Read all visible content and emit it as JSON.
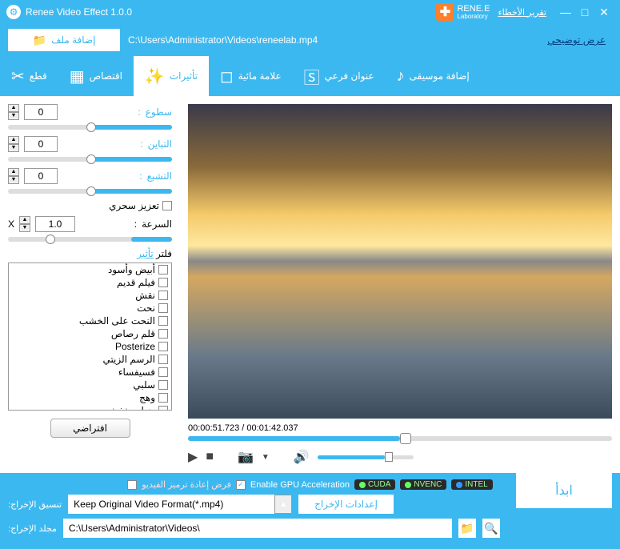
{
  "titlebar": {
    "title": "Renee Video Effect 1.0.0",
    "logo_name": "RENE.E",
    "logo_sub": "Laboratory",
    "bug_report": "تقرير الأخطاء"
  },
  "toolbar": {
    "add_file": "إضافة ملف",
    "file_path": "C:\\Users\\Administrator\\Videos\\reneelab.mp4",
    "demo": "عرض توضيحي"
  },
  "tabs": {
    "cut": "قطع",
    "crop": "اقتصاص",
    "effects": "تأثيرات",
    "watermark": "علامة مائية",
    "subtitle": "عنوان فرعي",
    "music": "إضافة موسيقى"
  },
  "sidebar": {
    "brightness": "سطوع",
    "contrast": "التباين",
    "saturation": "التشبع",
    "brightness_val": "0",
    "contrast_val": "0",
    "saturation_val": "0",
    "magic_enhance": "تعزيز سحري",
    "speed": "السرعة",
    "speed_val": "1.0",
    "speed_x": "X",
    "filter_label": "فلتر",
    "filter_link": "تأثير",
    "filters": [
      "أبيض وأسود",
      "فيلم قديم",
      "نقش",
      "نحت",
      "النحت على الخشب",
      "قلم رصاص",
      "Posterize",
      "الرسم الزيتي",
      "فسيفساء",
      "سلبي",
      "وهج",
      "ضباب خفيف"
    ],
    "default_btn": "افتراضي"
  },
  "preview": {
    "current_time": "00:00:51.723",
    "total_time": "00:01:42.037"
  },
  "bottom": {
    "force_reencode": "فرض إعادة ترميز الفيديو",
    "gpu_accel": "Enable GPU Acceleration",
    "cuda": "CUDA",
    "nvenc": "NVENC",
    "intel": "INTEL",
    "format_label": ":تنسيق الإخراج",
    "format_value": "Keep Original Video Format(*.mp4)",
    "output_settings": "إعدادات الإخراج",
    "start": "ابدأ",
    "dir_label": ":مجلد الإخراج",
    "dir_value": "C:\\Users\\Administrator\\Videos\\"
  }
}
